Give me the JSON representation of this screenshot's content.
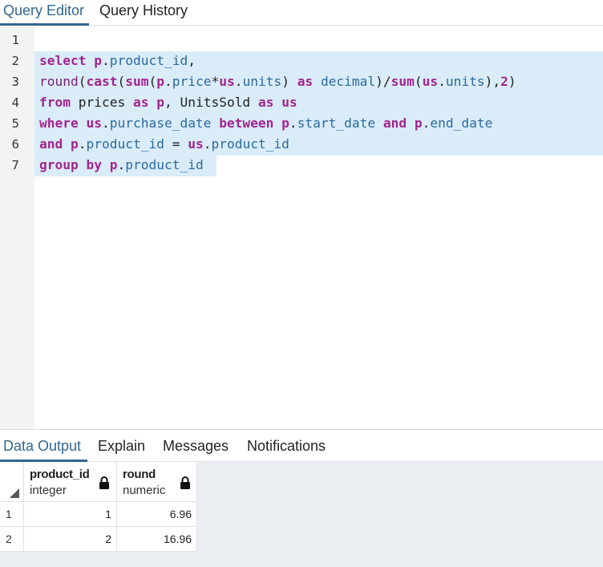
{
  "top_tabs": [
    {
      "label": "Query Editor",
      "active": true
    },
    {
      "label": "Query History",
      "active": false
    }
  ],
  "editor": {
    "line_numbers": [
      "1",
      "2",
      "3",
      "4",
      "5",
      "6",
      "7"
    ],
    "lines": [
      "",
      "select p.product_id,",
      "round(cast(sum(p.price*us.units) as decimal)/sum(us.units),2)",
      "from prices as p, UnitsSold as us",
      "where us.purchase_date between p.start_date and p.end_date",
      "and p.product_id = us.product_id",
      "group by p.product_id"
    ]
  },
  "output_tabs": [
    {
      "label": "Data Output",
      "active": true
    },
    {
      "label": "Explain",
      "active": false
    },
    {
      "label": "Messages",
      "active": false
    },
    {
      "label": "Notifications",
      "active": false
    }
  ],
  "result": {
    "columns": [
      {
        "name": "product_id",
        "type": "integer"
      },
      {
        "name": "round",
        "type": "numeric"
      }
    ],
    "rows": [
      {
        "num": "1",
        "cells": [
          "1",
          "6.96"
        ]
      },
      {
        "num": "2",
        "cells": [
          "2",
          "16.96"
        ]
      }
    ]
  },
  "icons": {
    "column_lock": "lock-icon",
    "sort_corner": "corner-triangle-icon"
  },
  "colors": {
    "accent": "#326690",
    "selection": "#d9ecf8",
    "keyword": "#a3248f",
    "identifier": "#2d6a9f"
  }
}
